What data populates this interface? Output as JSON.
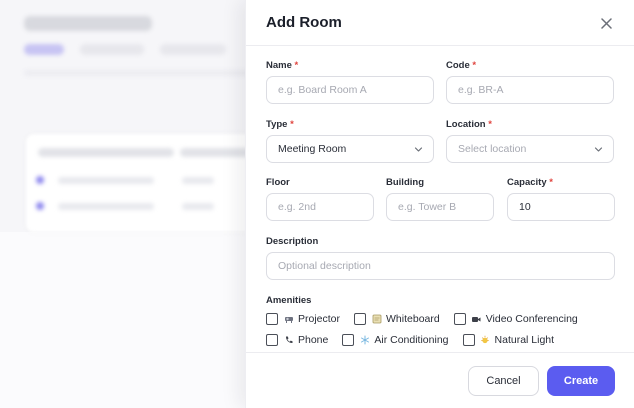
{
  "drawer": {
    "title": "Add Room",
    "close_icon": "close-icon"
  },
  "form": {
    "name": {
      "label": "Name",
      "required": "*",
      "placeholder": "e.g. Board Room A"
    },
    "code": {
      "label": "Code",
      "required": "*",
      "placeholder": "e.g. BR-A"
    },
    "type": {
      "label": "Type",
      "required": "*",
      "value": "Meeting Room"
    },
    "location": {
      "label": "Location",
      "required": "*",
      "placeholder": "Select location"
    },
    "floor": {
      "label": "Floor",
      "placeholder": "e.g. 2nd"
    },
    "building": {
      "label": "Building",
      "placeholder": "e.g. Tower B"
    },
    "capacity": {
      "label": "Capacity",
      "required": "*",
      "value": "10"
    },
    "description": {
      "label": "Description",
      "placeholder": "Optional description"
    }
  },
  "amenities": {
    "label": "Amenities",
    "items": [
      {
        "label": "Projector",
        "icon": "projector-icon",
        "checked": false
      },
      {
        "label": "Whiteboard",
        "icon": "whiteboard-icon",
        "checked": false
      },
      {
        "label": "Video Conferencing",
        "icon": "video-camera-icon",
        "checked": false
      },
      {
        "label": "Phone",
        "icon": "phone-icon",
        "checked": false
      },
      {
        "label": "Air Conditioning",
        "icon": "snowflake-icon",
        "checked": false
      },
      {
        "label": "Natural Light",
        "icon": "sun-icon",
        "checked": false
      }
    ]
  },
  "footer": {
    "cancel_label": "Cancel",
    "create_label": "Create"
  },
  "colors": {
    "accent": "#5b5cf0",
    "required": "#e0453f"
  }
}
